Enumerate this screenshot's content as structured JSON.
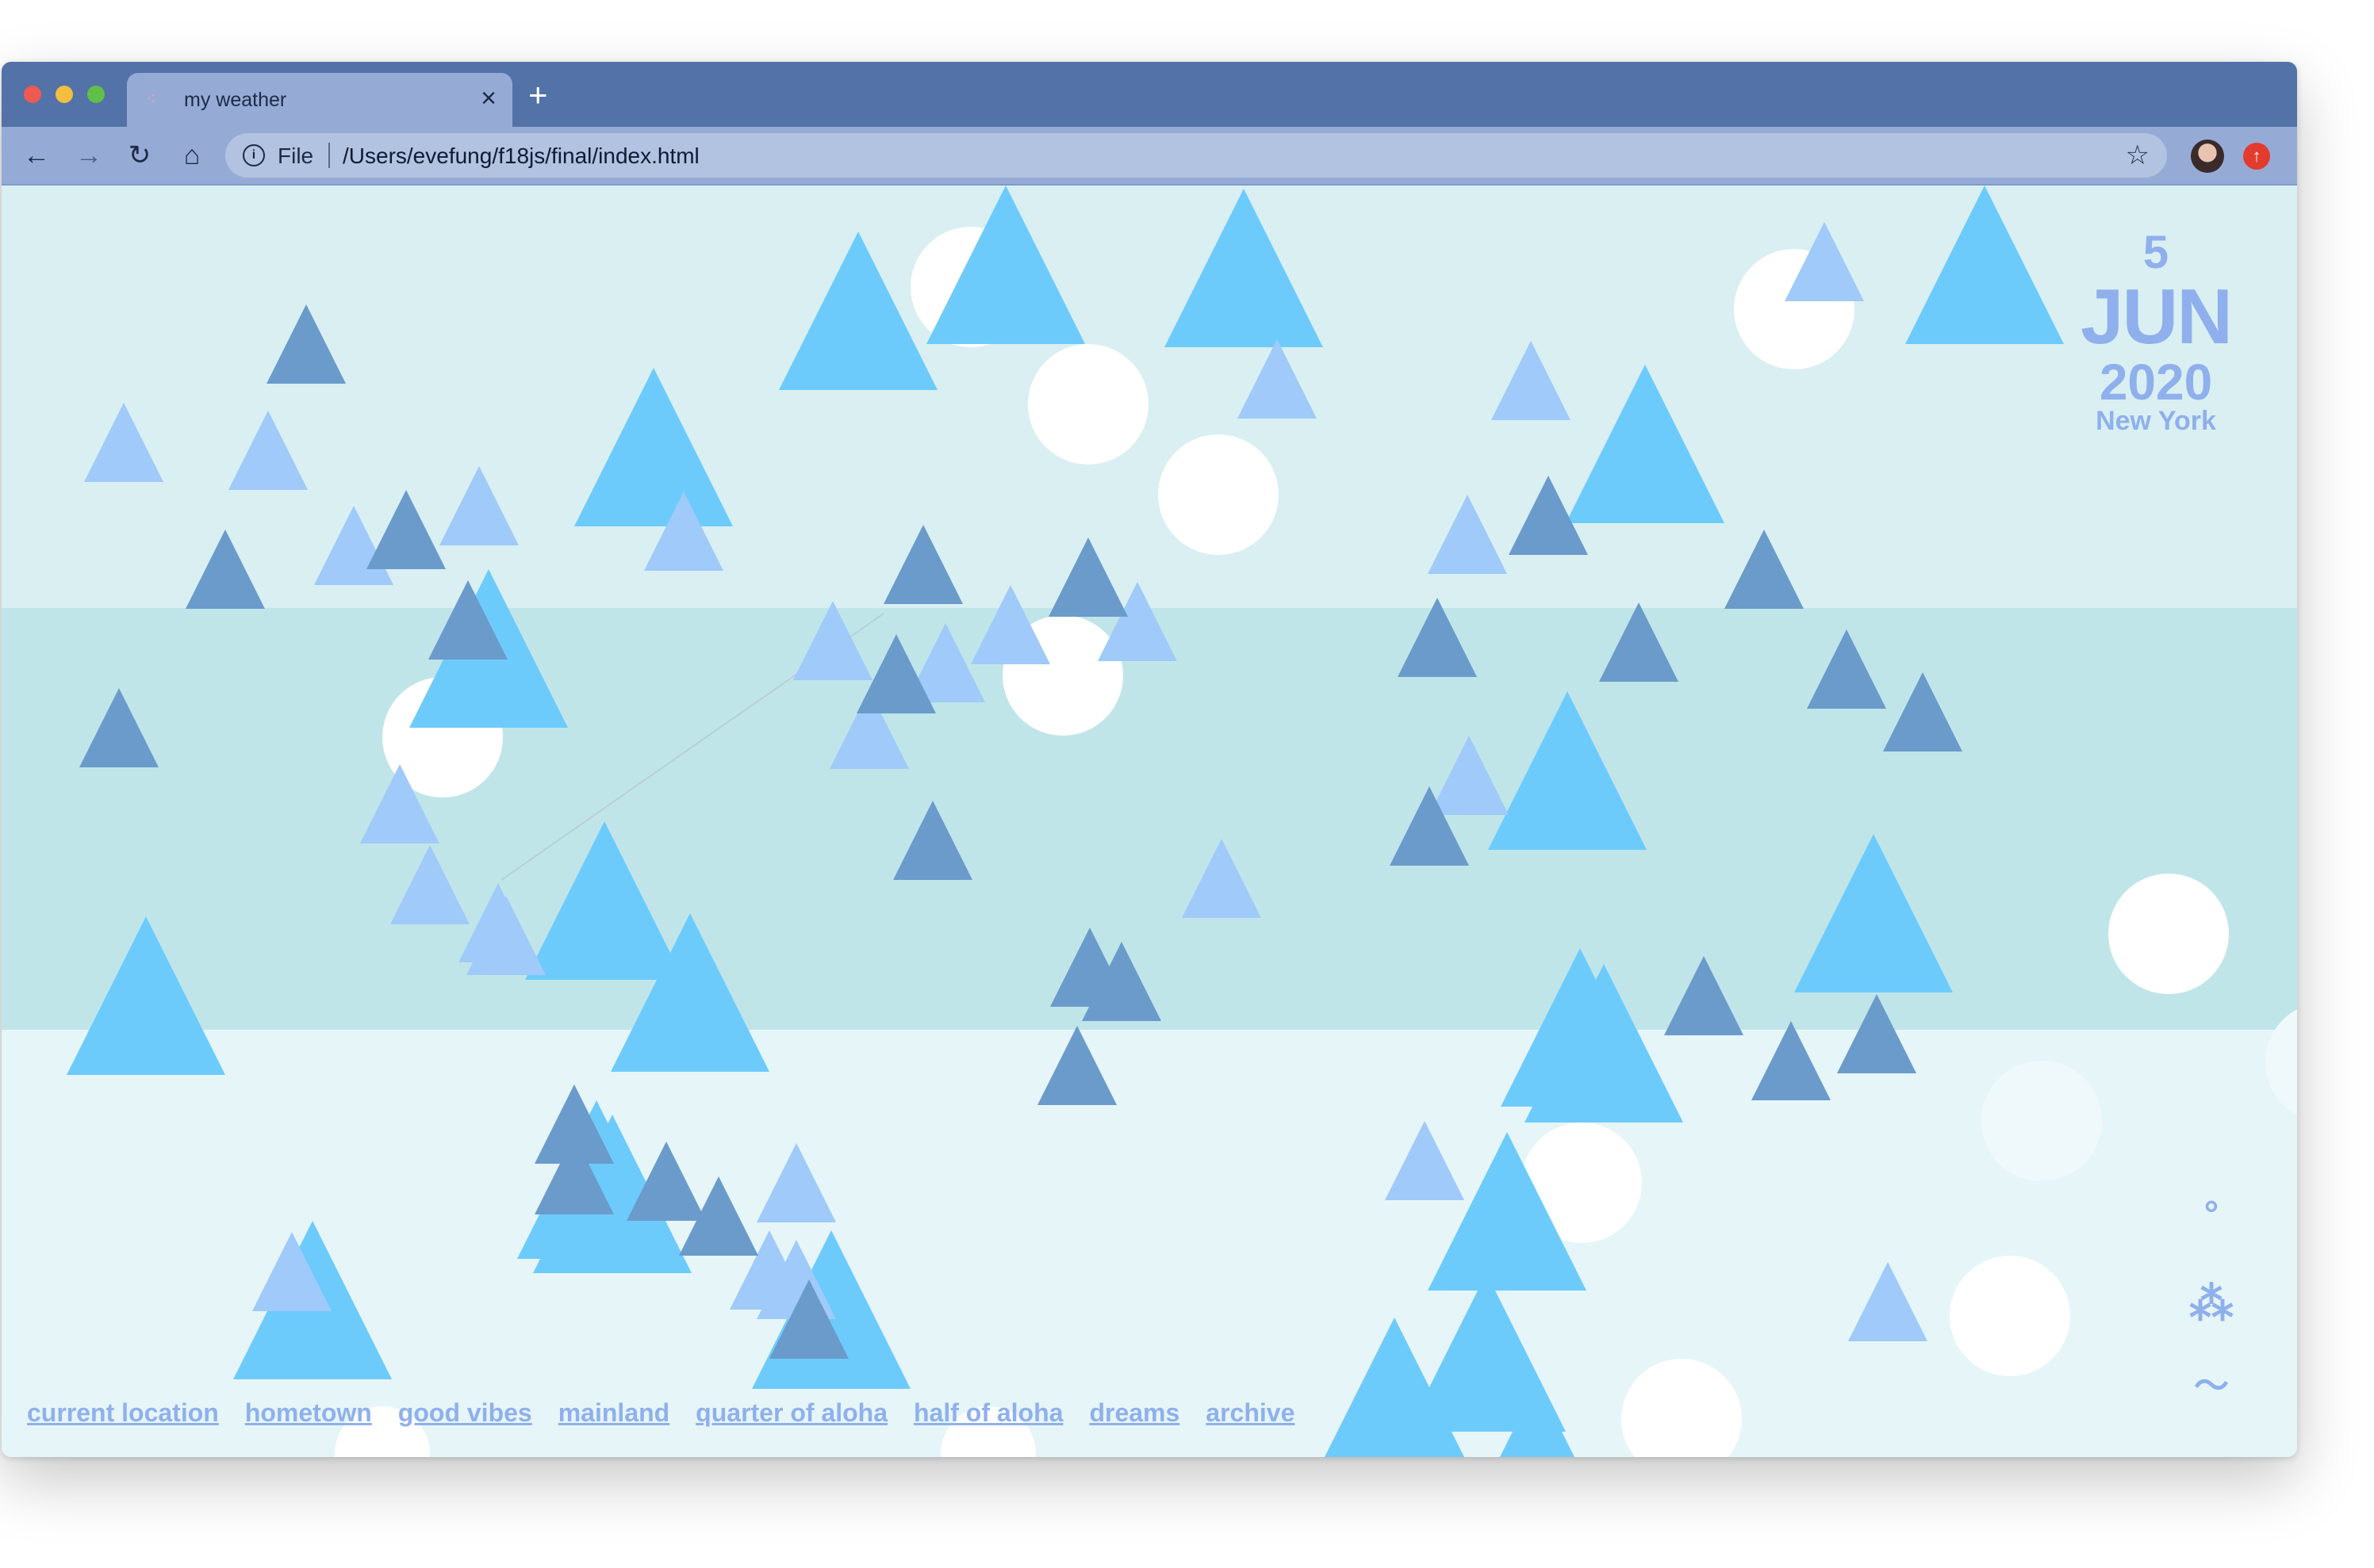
{
  "browser": {
    "tab_title": "my weather",
    "new_tab_label": "+",
    "address_scheme_label": "File",
    "address_url": "/Users/evefung/f18js/final/index.html"
  },
  "weather": {
    "day": "5",
    "month": "JUN",
    "year": "2020",
    "city": "New York",
    "indicators": [
      "°",
      "⁂",
      "〜"
    ]
  },
  "nav_links": [
    "current location",
    "hometown",
    "good vibes",
    "mainland",
    "quarter of aloha",
    "half of aloha",
    "dreams",
    "archive"
  ],
  "colors": {
    "sky_top": "#d9eff2",
    "sky_mid": "#c0e5e9",
    "sky_low": "#e6f5f8",
    "triangle_bright": "#6dcbfc",
    "triangle_light": "#9fcaf9",
    "triangle_dark": "#6a9bcb",
    "accent_text": "#8fb0ec",
    "titlebar": "#5372a7",
    "toolbar": "#95abd6"
  }
}
